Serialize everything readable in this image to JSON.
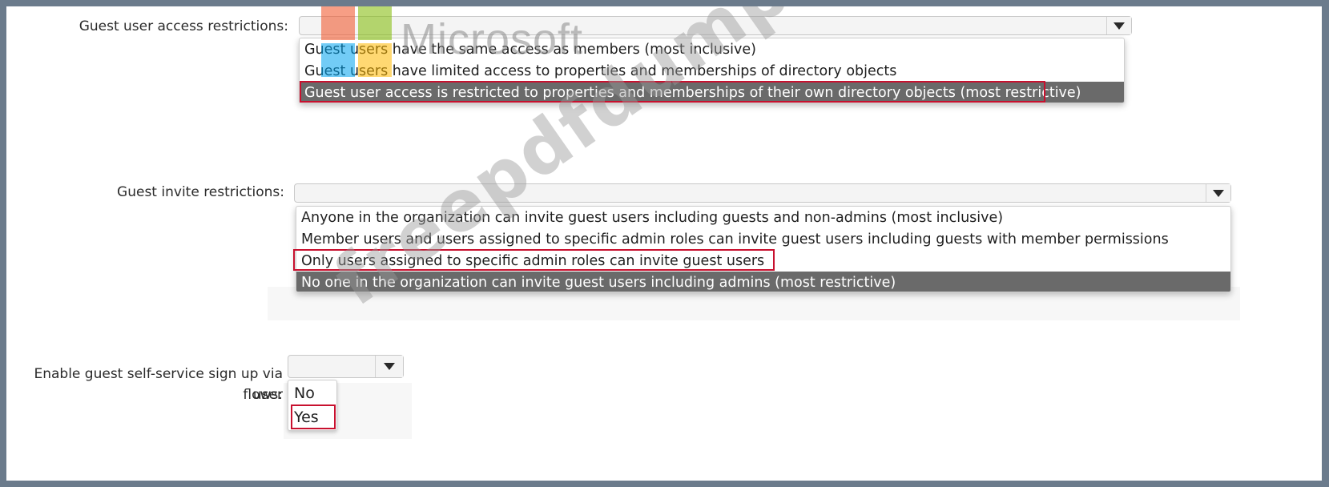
{
  "guest_access": {
    "label": "Guest user access restrictions:",
    "options": [
      "Guest users have the same access as members (most inclusive)",
      "Guest users have limited access to properties and memberships of directory objects",
      "Guest user access is restricted to properties and memberships of their own directory objects (most restrictive)"
    ],
    "highlighted_index": 2
  },
  "guest_invite": {
    "label": "Guest invite restrictions:",
    "options": [
      "Anyone in the organization can invite guest users including guests and non-admins (most inclusive)",
      "Member users and users assigned to specific admin roles can invite guest users including guests with member permissions",
      "Only users assigned to specific admin roles can invite guest users",
      "No one in the organization can invite guest users including admins (most restrictive)"
    ],
    "highlighted_index": 3
  },
  "self_service": {
    "label_line1": "Enable guest self-service sign up via user",
    "label_line2": "flows:",
    "options": [
      "No",
      "Yes"
    ]
  },
  "logo": {
    "name": "Microsoft",
    "colors": [
      "#f25022",
      "#7fba00",
      "#00a4ef",
      "#ffb900"
    ]
  },
  "watermark": "freepdfdumps.com",
  "colors": {
    "selected_bg": "#6a6a6a",
    "highlight_border": "#c8102e"
  }
}
